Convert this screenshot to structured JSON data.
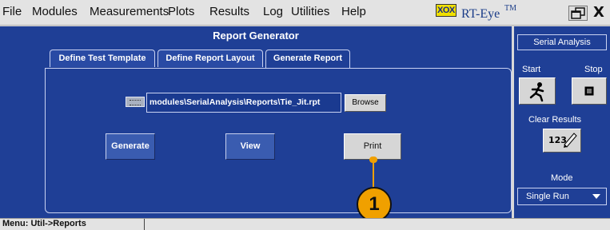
{
  "menu": {
    "items": [
      "File",
      "Modules",
      "Measurements",
      "Plots",
      "Results",
      "Log",
      "Utilities",
      "Help"
    ]
  },
  "app": {
    "logo_text": "XOX",
    "name": "RT-Eye",
    "tm": "TM",
    "close_label": "X"
  },
  "report_generator": {
    "title": "Report Generator",
    "tabs": [
      {
        "label": "Define Test Template",
        "active": false
      },
      {
        "label": "Define Report Layout",
        "active": false
      },
      {
        "label": "Generate Report",
        "active": true
      }
    ],
    "path_value": "modules\\SerialAnalysis\\Reports\\Tie_Jit.rpt",
    "browse_label": "Browse",
    "generate_label": "Generate",
    "view_label": "View",
    "print_label": "Print"
  },
  "callout": {
    "number": "1",
    "color": "#f0a000"
  },
  "serial_analysis": {
    "title": "Serial Analysis",
    "start_label": "Start",
    "stop_label": "Stop",
    "start_icon": "running-man-icon",
    "stop_icon": "stop-square-icon",
    "clear_label": "Clear Results",
    "clear_icon_text": "123",
    "mode_label": "Mode",
    "mode_value": "Single Run"
  },
  "status_bar": {
    "text": "Menu: Util->Reports"
  },
  "colors": {
    "panel_blue": "#1f3f96",
    "accent_orange": "#f0a000"
  }
}
